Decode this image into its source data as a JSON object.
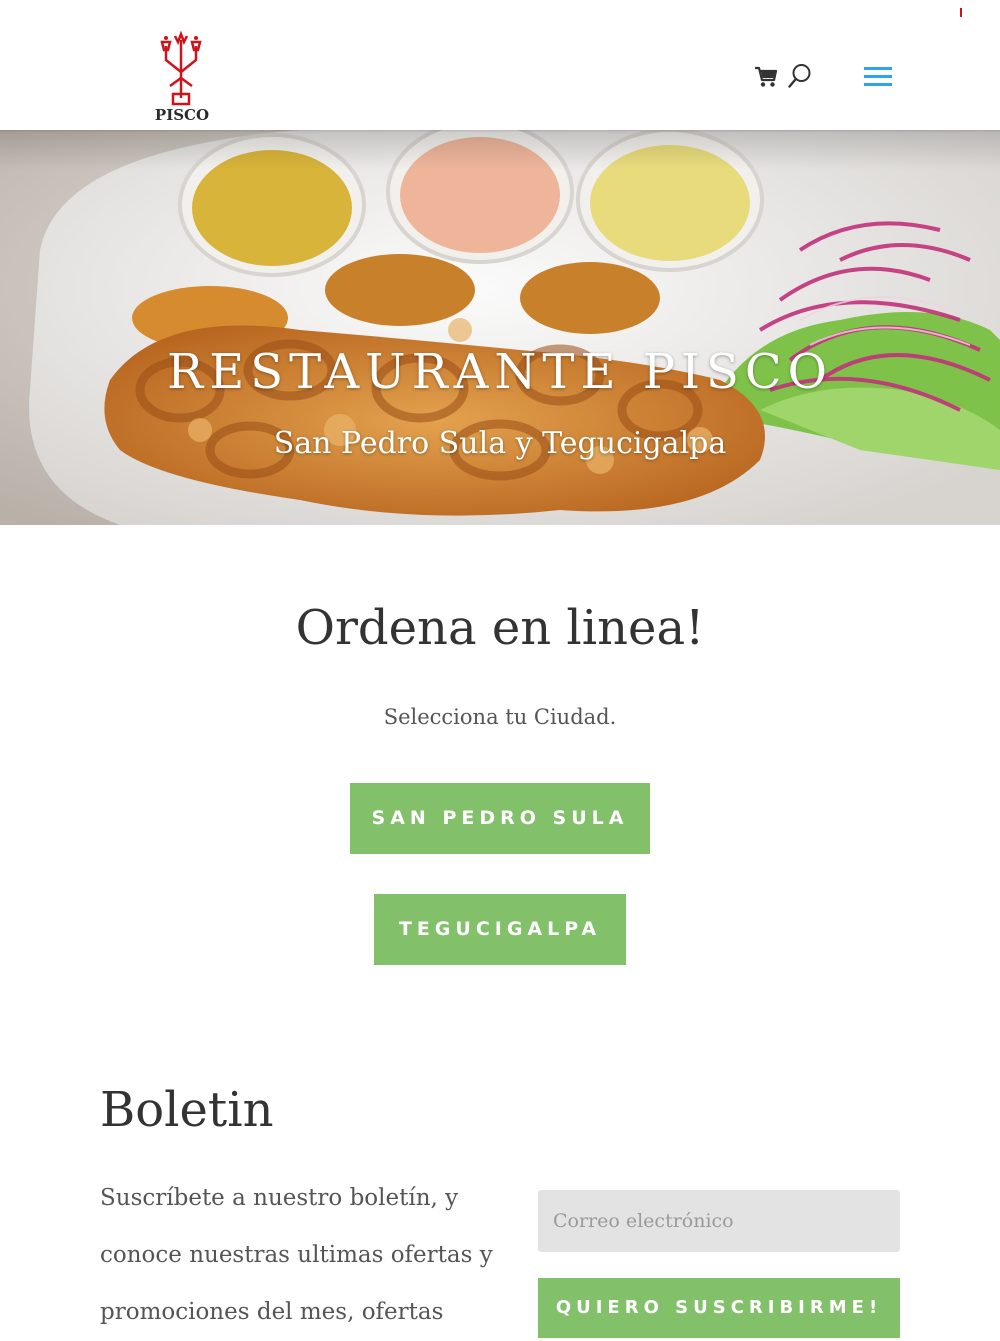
{
  "brand": {
    "logo_text": "PISCO",
    "accent_color": "#d0121b"
  },
  "header": {
    "icons": [
      "cart-icon",
      "search-icon",
      "hamburger-menu-icon"
    ],
    "menu_color": "#2ea3f2"
  },
  "hero": {
    "title": "RESTAURANTE PISCO",
    "subtitle": "San Pedro Sula y Tegucigalpa"
  },
  "order": {
    "heading": "Ordena en linea!",
    "subheading": "Selecciona tu Ciudad.",
    "buttons": [
      {
        "label": "SAN PEDRO SULA"
      },
      {
        "label": "TEGUCIGALPA"
      }
    ],
    "button_color": "#82c06a"
  },
  "newsletter": {
    "heading": "Boletin",
    "text": "Suscríbete a nuestro boletín, y conoce nuestras ultimas ofertas y promociones del mes, ofertas",
    "email_placeholder": "Correo electrónico",
    "submit_label": "QUIERO SUSCRIBIRME!"
  }
}
